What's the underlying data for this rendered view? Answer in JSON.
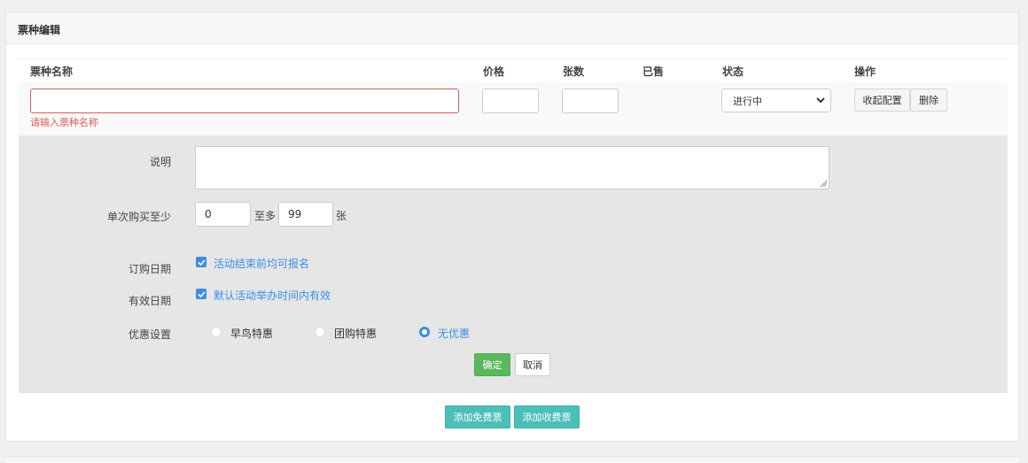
{
  "panel": {
    "title": "票种编辑"
  },
  "table": {
    "headers": {
      "name": "票种名称",
      "price": "价格",
      "count": "张数",
      "sold": "已售",
      "status": "状态",
      "ops": "操作"
    }
  },
  "row": {
    "name_value": "",
    "name_error": "请输入票种名称",
    "price_value": "",
    "count_value": "",
    "status_selected": "进行中",
    "collapse_label": "收起配置",
    "delete_label": "删除"
  },
  "config": {
    "desc_label": "说明",
    "desc_value": "",
    "min_buy_label": "单次购买至少",
    "min_buy_value": "0",
    "max_sep": "至多",
    "max_buy_value": "99",
    "unit": "张",
    "order_date_label": "订购日期",
    "order_date_check": "活动结束前均可报名",
    "valid_date_label": "有效日期",
    "valid_date_check": "默认活动举办时间内有效",
    "discount_label": "优惠设置",
    "discount_options": [
      "早鸟特惠",
      "团购特惠",
      "无优惠"
    ],
    "discount_selected": "无优惠",
    "confirm_label": "确定",
    "cancel_label": "取消"
  },
  "actions": {
    "add_free": "添加免费票",
    "add_paid": "添加收费票"
  },
  "colors": {
    "accent": "#3d8fe0",
    "error": "#e05a5a",
    "confirm": "#5cb85c",
    "teal": "#4bbfb8"
  }
}
